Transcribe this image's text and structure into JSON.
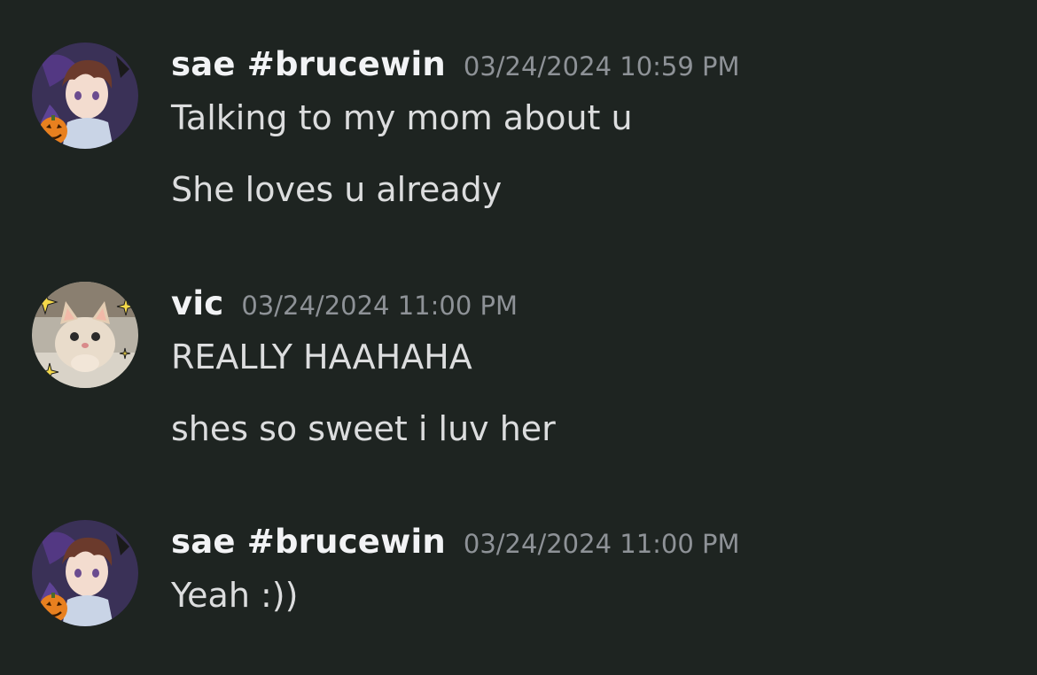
{
  "messages": [
    {
      "author": "sae #brucewin",
      "timestamp": "03/24/2024 10:59 PM",
      "avatar_icon": "anime-boy-pumpkin-avatar",
      "lines": [
        "Talking to my mom about u",
        "She loves u already"
      ]
    },
    {
      "author": "vic",
      "timestamp": "03/24/2024 11:00 PM",
      "avatar_icon": "kitten-sparkles-avatar",
      "lines": [
        "REALLY HAAHAHA",
        "shes so sweet i luv her"
      ]
    },
    {
      "author": "sae #brucewin",
      "timestamp": "03/24/2024 11:00 PM",
      "avatar_icon": "anime-boy-pumpkin-avatar",
      "lines": [
        "Yeah :))"
      ]
    }
  ],
  "colors": {
    "background": "#1e2421",
    "username": "#f2f3f5",
    "timestamp": "#8e9297",
    "message_text": "#dcddde"
  }
}
